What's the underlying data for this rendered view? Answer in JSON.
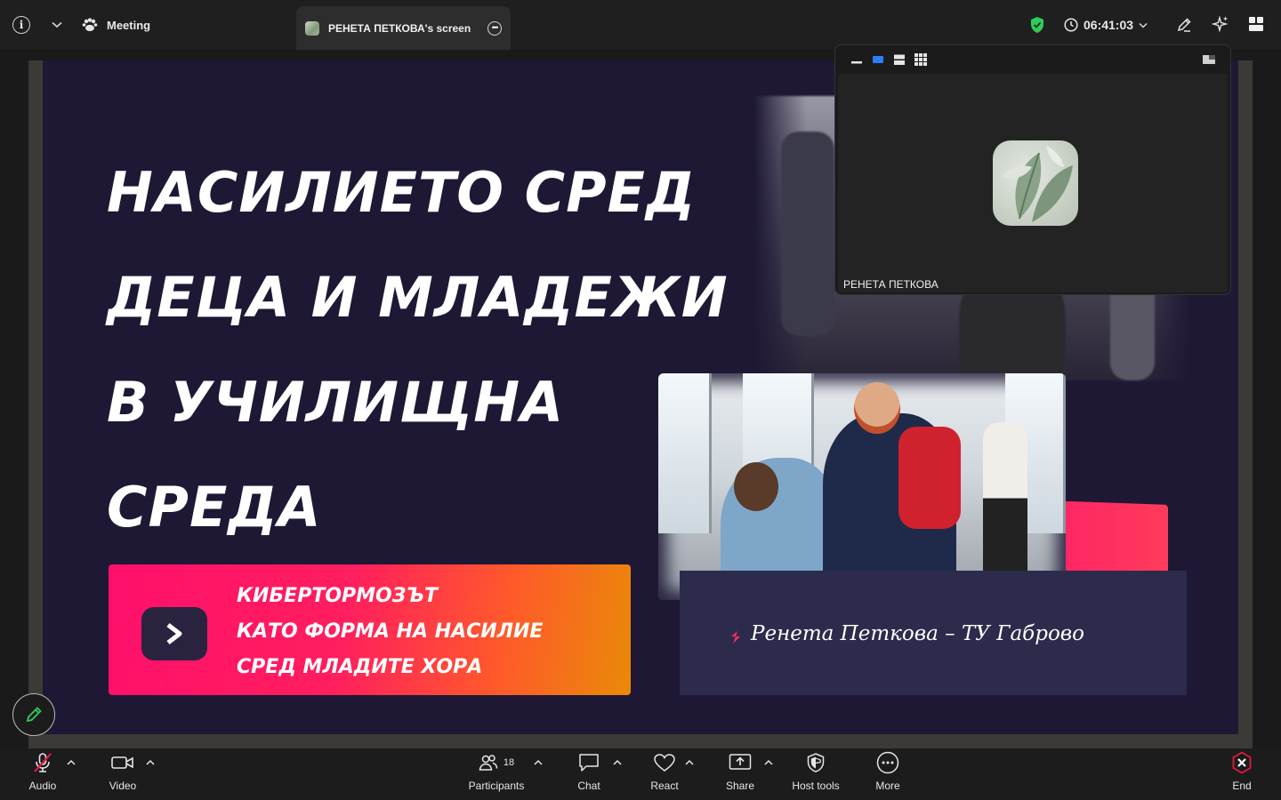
{
  "topbar": {
    "meeting_label": "Meeting",
    "share_tab_label": "РЕНЕТА ПЕТКОВА's screen",
    "timer": "06:41:03",
    "shield_color": "#2ecc5a"
  },
  "slide": {
    "title_lines": [
      "НАСИЛИЕТО СРЕД",
      "ДЕЦА И МЛАДЕЖИ",
      "В УЧИЛИЩНА",
      "СРЕДА"
    ],
    "button_lines": [
      "КИБЕРТОРМОЗЪТ",
      "КАТО ФОРМА НА НАСИЛИЕ",
      "СРЕД МЛАДИТЕ ХОРА"
    ],
    "author": "Ренета Петкова – ТУ Габрово",
    "background_color": "#1e1835",
    "accent_color": "#ff1e6a"
  },
  "video": {
    "participant_name": "РЕНЕТА ПЕТКОВА"
  },
  "toolbar": {
    "audio_label": "Audio",
    "video_label": "Video",
    "participants_label": "Participants",
    "participants_count": "18",
    "chat_label": "Chat",
    "react_label": "React",
    "share_label": "Share",
    "host_tools_label": "Host tools",
    "more_label": "More",
    "end_label": "End",
    "end_color": "#e5173f"
  }
}
